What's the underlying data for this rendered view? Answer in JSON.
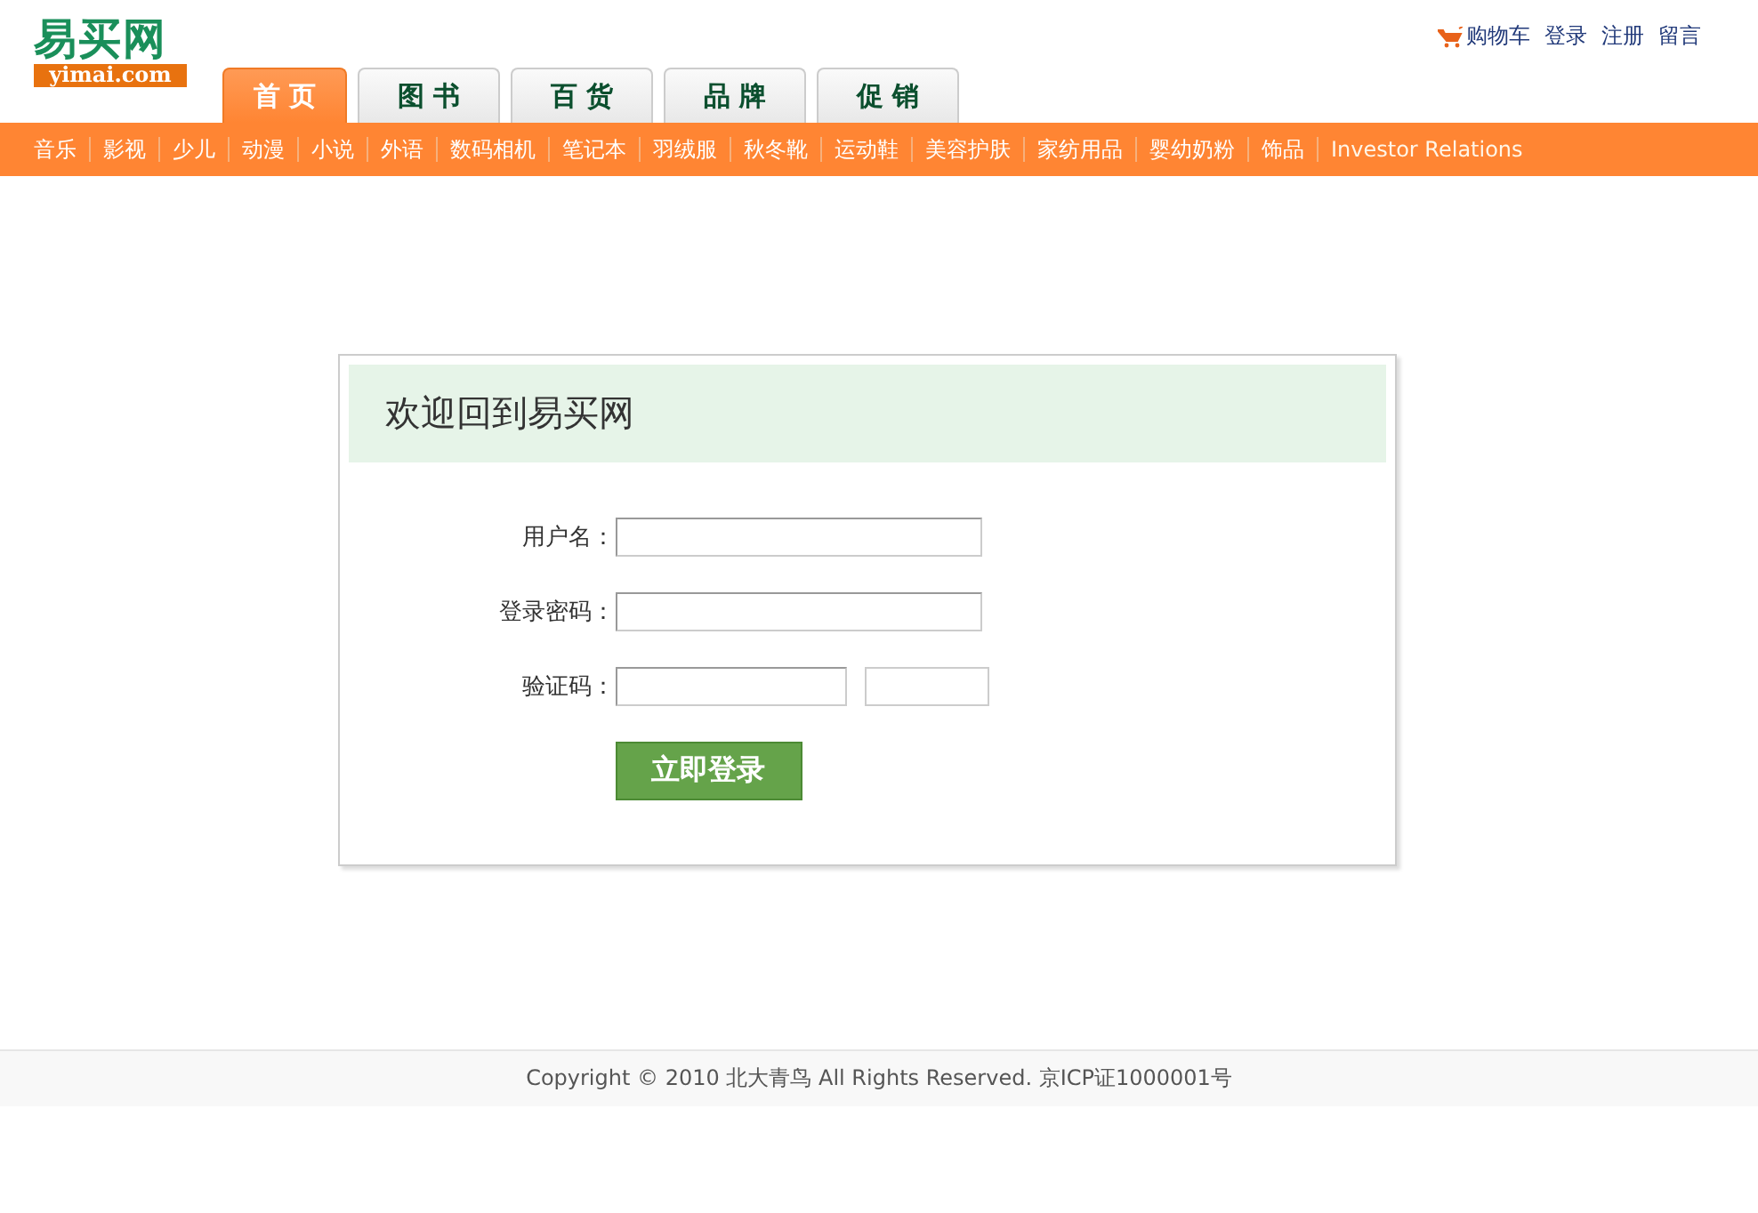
{
  "logo": {
    "name": "易买网",
    "domain": "yimai.com"
  },
  "top_links": [
    {
      "label": "购物车",
      "kind": "cart"
    },
    {
      "label": "登录",
      "kind": "link"
    },
    {
      "label": "注册",
      "kind": "link"
    },
    {
      "label": "留言",
      "kind": "link"
    }
  ],
  "tabs": [
    {
      "label": "首 页",
      "selected": true
    },
    {
      "label": "图 书",
      "selected": false
    },
    {
      "label": "百 货",
      "selected": false
    },
    {
      "label": "品 牌",
      "selected": false
    },
    {
      "label": "促 销",
      "selected": false
    }
  ],
  "categories": [
    "音乐",
    "影视",
    "少儿",
    "动漫",
    "小说",
    "外语",
    "数码相机",
    "笔记本",
    "羽绒服",
    "秋冬靴",
    "运动鞋",
    "美容护肤",
    "家纺用品",
    "婴幼奶粉",
    "饰品",
    "Investor Relations"
  ],
  "login": {
    "title": "欢迎回到易买网",
    "fields": [
      {
        "label": "用户名：",
        "kind": "text"
      },
      {
        "label": "登录密码：",
        "kind": "password"
      },
      {
        "label": "验证码：",
        "kind": "captcha"
      }
    ],
    "button": "立即登录"
  },
  "footer": "Copyright © 2010 北大青鸟 All Rights Reserved. 京ICP证1000001号"
}
